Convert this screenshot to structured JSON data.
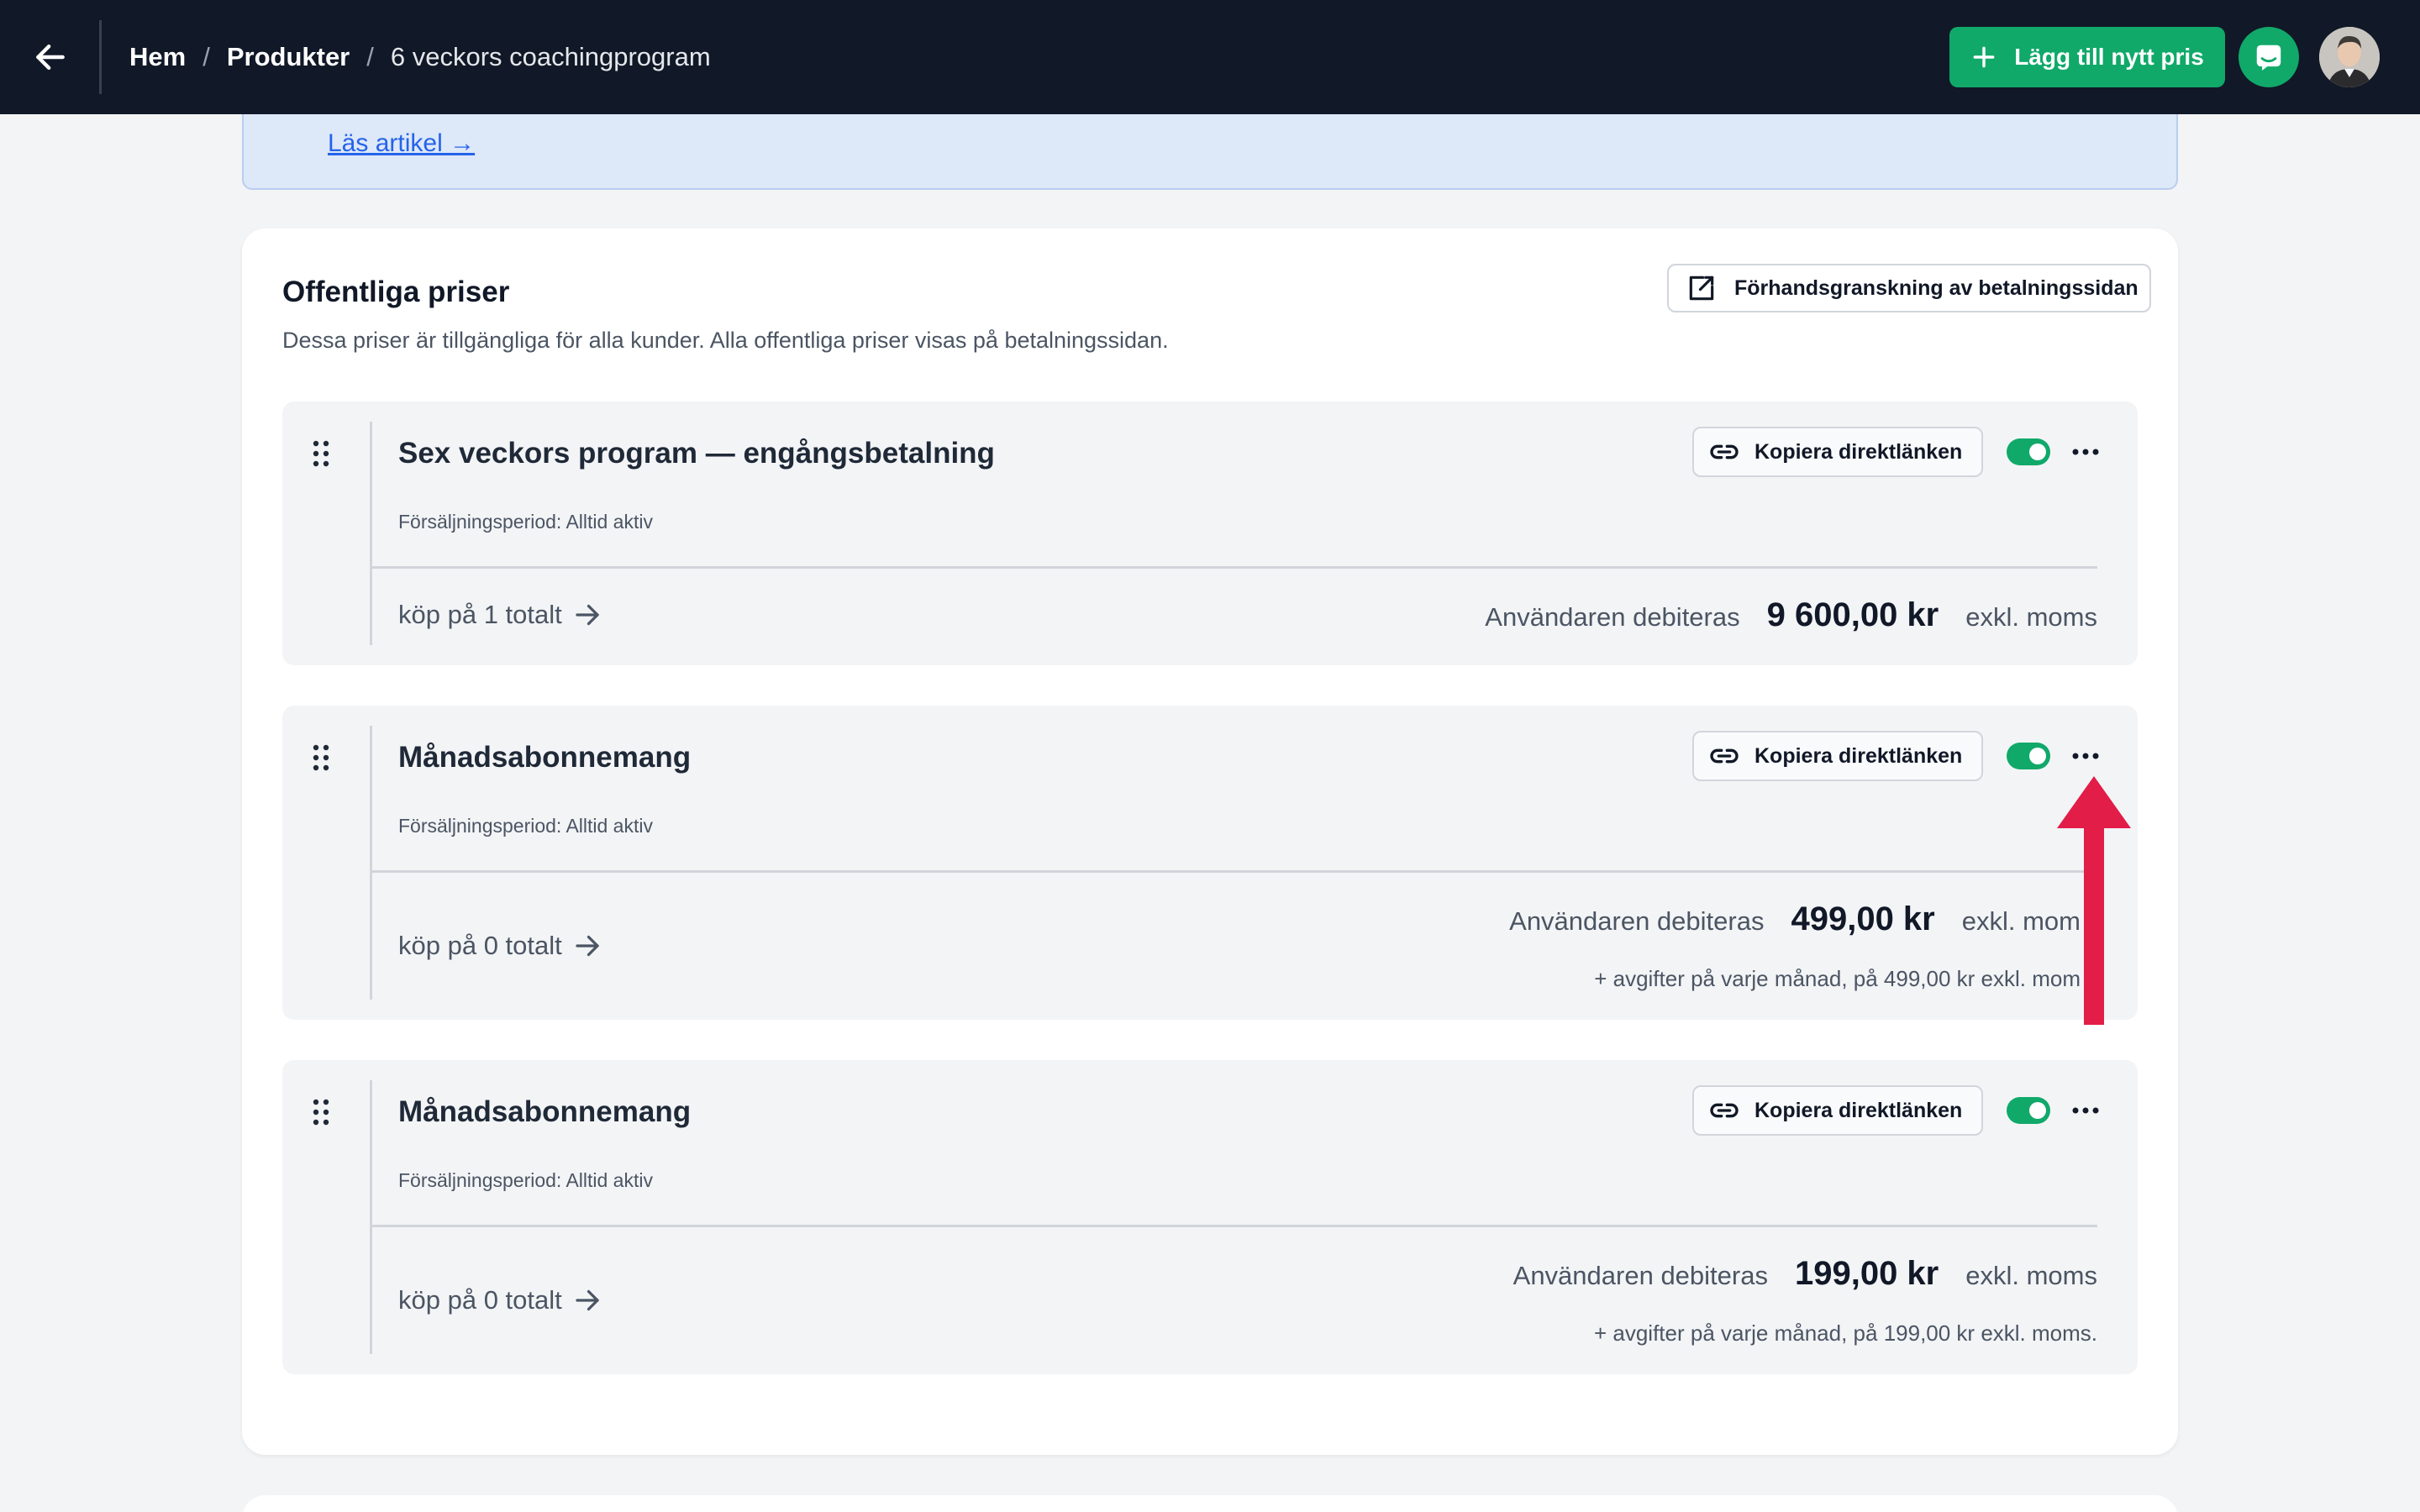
{
  "header": {
    "breadcrumb": {
      "home": "Hem",
      "products": "Produkter",
      "current": "6 veckors coachingprogram",
      "separator": "/"
    },
    "add_price_label": "Lägg till nytt pris"
  },
  "banner": {
    "link_label": "Läs artikel →"
  },
  "section": {
    "title": "Offentliga priser",
    "subtitle": "Dessa priser är tillgängliga för alla kunder. Alla offentliga priser visas på betalningssidan.",
    "preview_label": "Förhandsgranskning av betalningssidan"
  },
  "prices": [
    {
      "title": "Sex veckors program — engångsbetalning",
      "period": "Försäljningsperiod: Alltid aktiv",
      "copy_label": "Kopiera direktlänken",
      "active": true,
      "purchases": "köp på 1 totalt",
      "charge_prefix": "Användaren debiteras",
      "amount": "9 600,00 kr",
      "tax_note": "exkl. moms"
    },
    {
      "title": "Månadsabonnemang",
      "period": "Försäljningsperiod: Alltid aktiv",
      "copy_label": "Kopiera direktlänken",
      "active": true,
      "purchases": "köp på 0 totalt",
      "charge_prefix": "Användaren debiteras",
      "amount": "499,00 kr",
      "tax_note": "exkl. mom",
      "fee_note": "+ avgifter på varje månad, på 499,00 kr exkl. mom"
    },
    {
      "title": "Månadsabonnemang",
      "period": "Försäljningsperiod: Alltid aktiv",
      "copy_label": "Kopiera direktlänken",
      "active": true,
      "purchases": "köp på 0 totalt",
      "charge_prefix": "Användaren debiteras",
      "amount": "199,00 kr",
      "tax_note": "exkl. moms",
      "fee_note": "+ avgifter på varje månad, på 199,00 kr exkl. moms."
    }
  ],
  "colors": {
    "topbar": "#111827",
    "accent_green": "#10a96a",
    "annotation_red": "#e11d48",
    "banner_bg": "#dde8f8",
    "link_blue": "#2563eb"
  },
  "icons": {
    "back": "arrow-left-icon",
    "add": "plus-icon",
    "chat": "chat-bubble-icon",
    "preview": "external-link-icon",
    "copy": "link-icon",
    "drag": "drag-handle-icon",
    "more": "more-horizontal-icon",
    "purchases": "arrow-right-icon"
  }
}
